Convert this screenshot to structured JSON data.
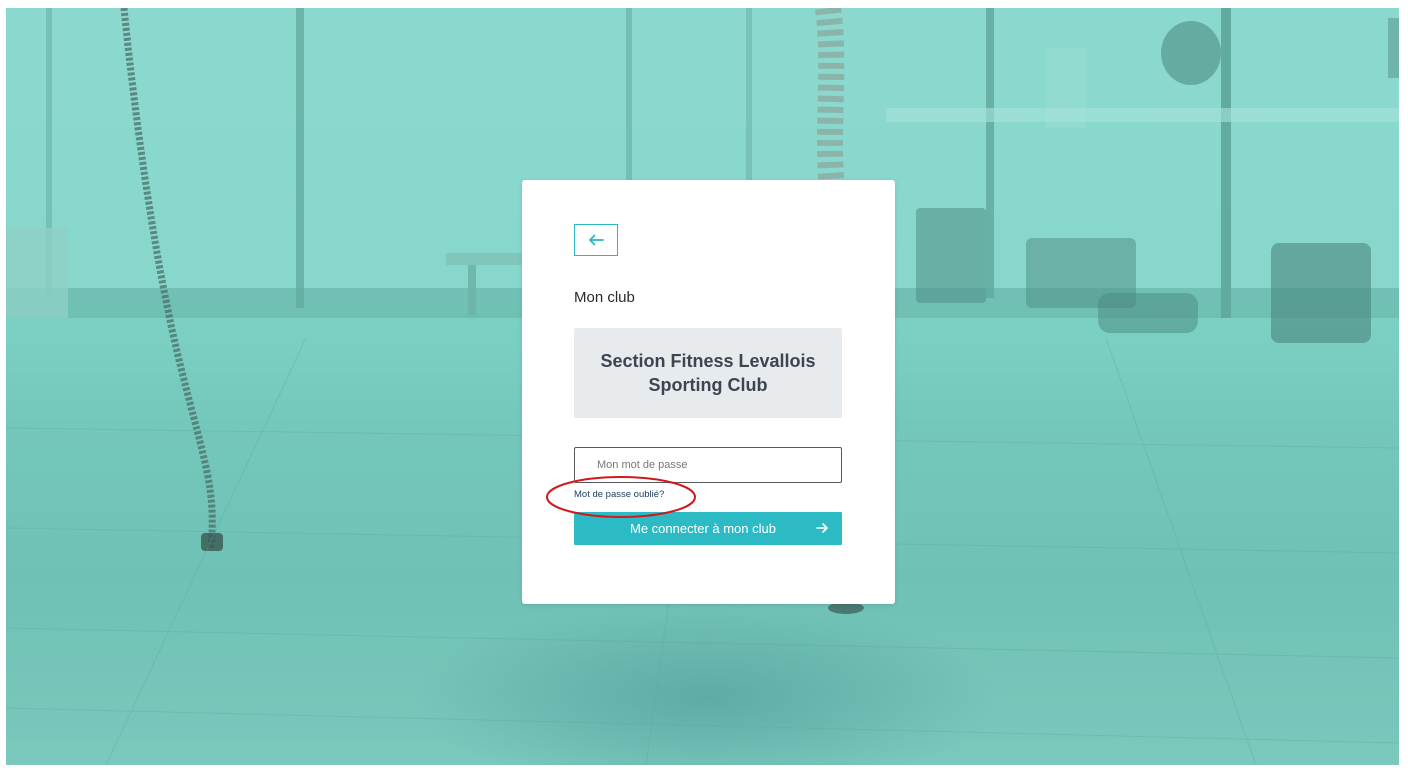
{
  "login": {
    "back_icon": "arrow-left-icon",
    "section_label": "Mon club",
    "club_name": "Section Fitness Levallois Sporting Club",
    "password_placeholder": "Mon mot de passe",
    "password_value": "",
    "forgot_password": "Mot de passe oublié?",
    "connect_label": "Me connecter à mon club",
    "connect_icon": "arrow-right-icon"
  },
  "colors": {
    "accent": "#2cbbc5",
    "overlay": "#7dd2c6",
    "annotation": "#d0191b"
  }
}
